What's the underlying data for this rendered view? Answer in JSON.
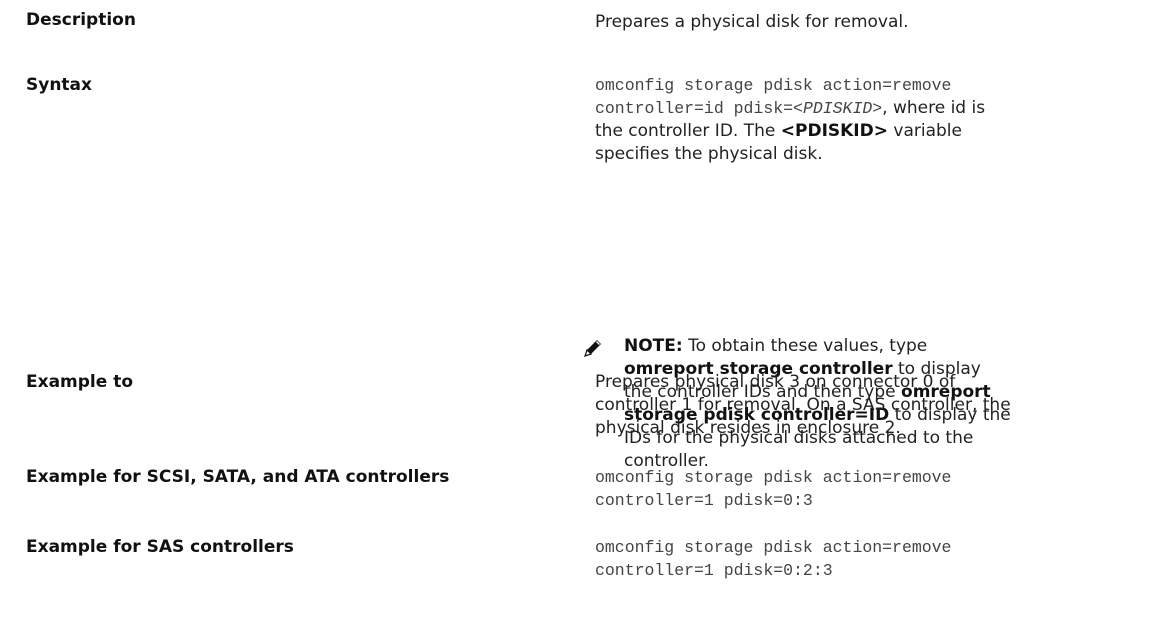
{
  "rows": [
    {
      "label": "Description",
      "text": "Prepares a physical disk for removal."
    },
    {
      "label": "Syntax",
      "code_line1": "omconfig storage pdisk action=remove",
      "code_line2_prefix": "controller=id pdisk=<",
      "code_var": "PDISKID",
      "code_gt": ">",
      "text_after_code": ", where id is the controller ID. The ",
      "bold_var": "<PDISKID>",
      "text_end": " variable specifies the physical disk."
    },
    {
      "label": "Example to",
      "text": "Prepares physical disk 3 on connector 0 of controller 1 for removal. On a SAS controller, the physical disk resides in enclosure 2."
    },
    {
      "label": "Example for SCSI, SATA, and ATA controllers",
      "code_line1": "omconfig storage pdisk action=remove",
      "code_line2": "controller=1 pdisk=0:3"
    },
    {
      "label": "Example for SAS controllers",
      "code_line1": "omconfig storage pdisk action=remove",
      "code_line2": "controller=1 pdisk=0:2:3"
    }
  ],
  "note": {
    "icon": "pencil-note-icon",
    "prefix": "NOTE:",
    "t1": " To obtain these values, type ",
    "b1": "omreport storage controller",
    "t2": " to display the controller IDs and then type ",
    "b2": "omreport storage pdisk controller=ID",
    "t3": " to display the IDs for the physical disks attached to the controller."
  }
}
